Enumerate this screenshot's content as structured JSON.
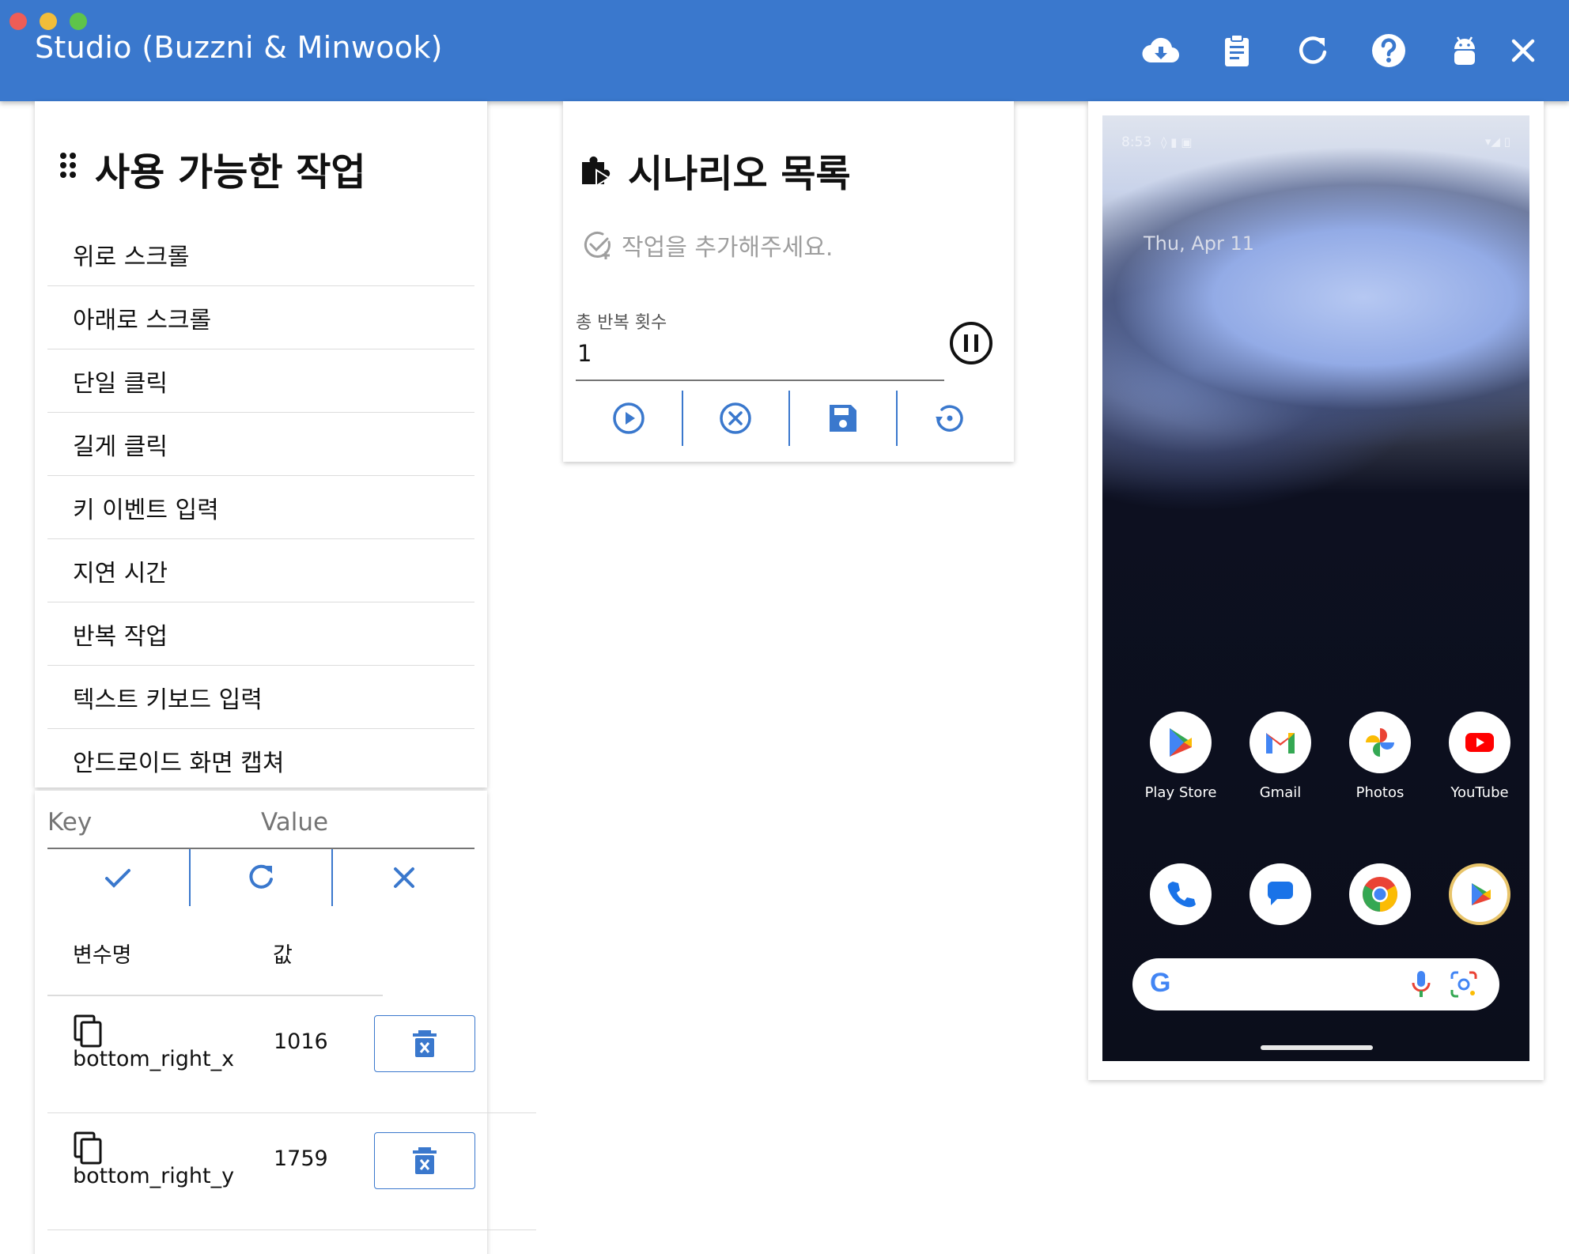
{
  "app": {
    "title": "Studio (Buzzni & Minwook)"
  },
  "actions": {
    "title": "사용 가능한 작업",
    "items": [
      "위로 스크롤",
      "아래로 스크롤",
      "단일 클릭",
      "길게 클릭",
      "키 이벤트 입력",
      "지연 시간",
      "반복 작업",
      "텍스트 키보드 입력",
      "안드로이드 화면 캡쳐"
    ]
  },
  "variables": {
    "key_placeholder": "Key",
    "value_placeholder": "Value",
    "header_name": "변수명",
    "header_value": "값",
    "rows": [
      {
        "name": "bottom_right_x",
        "value": "1016"
      },
      {
        "name": "bottom_right_y",
        "value": "1759"
      }
    ]
  },
  "scenario": {
    "title": "시나리오 목록",
    "placeholder": "작업을 추가해주세요.",
    "repeat_label": "총 반복 횟수",
    "repeat_value": "1"
  },
  "phone": {
    "time": "8:53",
    "date": "Thu, Apr 11",
    "apps": [
      {
        "label": "Play Store",
        "icon": "play-store-icon"
      },
      {
        "label": "Gmail",
        "icon": "gmail-icon"
      },
      {
        "label": "Photos",
        "icon": "photos-icon"
      },
      {
        "label": "YouTube",
        "icon": "youtube-icon"
      }
    ],
    "dock": [
      "phone-icon",
      "messages-icon",
      "chrome-icon",
      "play-games-icon"
    ],
    "search_logo": "G"
  },
  "colors": {
    "accent": "#3a78cd",
    "titlebar": "#3a78cd"
  }
}
